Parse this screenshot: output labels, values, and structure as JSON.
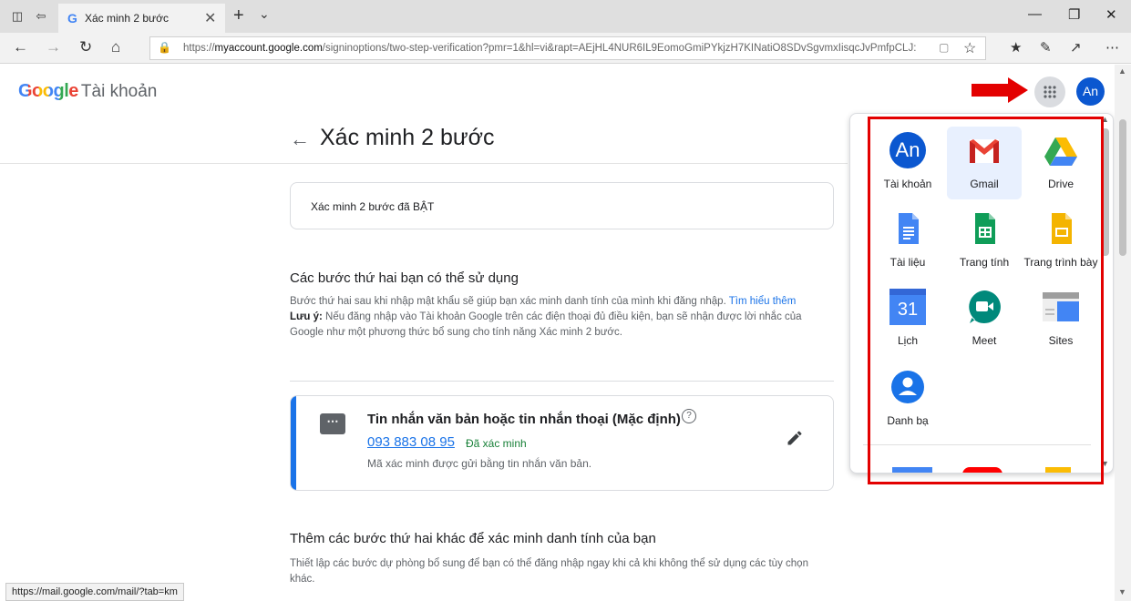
{
  "browser": {
    "tab_title": "Xác minh 2 bước",
    "tab_favicon": "G",
    "url_prefix": "https://",
    "url_domain": "myaccount.google.com",
    "url_rest": "/signinoptions/two-step-verification?pmr=1&hl=vi&rapt=AEjHL4NUR6IL9EomoGmiPYkjzH7KINatiO8SDvSgvmxIisqcJvPmfpCLJ:"
  },
  "header": {
    "logo_google": "Google",
    "logo_account": "Tài khoản",
    "avatar_initials": "An"
  },
  "page": {
    "title": "Xác minh 2 bước",
    "status_text": "Xác minh 2 bước đã BẬT",
    "section1": {
      "heading": "Các bước thứ hai bạn có thể sử dụng",
      "desc": "Bước thứ hai sau khi nhập mật khẩu sẽ giúp bạn xác minh danh tính của mình khi đăng nhập.",
      "link": "Tìm hiểu thêm",
      "note_label": "Lưu ý:",
      "note_text": "Nếu đăng nhập vào Tài khoản Google trên các điện thoại đủ điều kiện, bạn sẽ nhận được lời nhắc của Google như một phương thức bổ sung cho tính năng Xác minh 2 bước."
    },
    "method": {
      "title": "Tin nhắn văn bản hoặc tin nhắn thoại (Mặc định)",
      "phone": "093 883 08 95",
      "verified": "Đã xác minh",
      "desc": "Mã xác minh được gửi bằng tin nhắn văn bản."
    },
    "section2": {
      "heading": "Thêm các bước thứ hai khác để xác minh danh tính của bạn",
      "desc": "Thiết lập các bước dự phòng bổ sung để bạn có thể đăng nhập ngay khi cả khi không thể sử dụng các tùy chọn khác."
    }
  },
  "apps": {
    "items": [
      {
        "label": "Tài khoản",
        "icon": "account-icon"
      },
      {
        "label": "Gmail",
        "icon": "gmail-icon"
      },
      {
        "label": "Drive",
        "icon": "drive-icon"
      },
      {
        "label": "Tài liệu",
        "icon": "docs-icon"
      },
      {
        "label": "Trang tính",
        "icon": "sheets-icon"
      },
      {
        "label": "Trang trình bày",
        "icon": "slides-icon"
      },
      {
        "label": "Lịch",
        "icon": "calendar-icon"
      },
      {
        "label": "Meet",
        "icon": "meet-icon"
      },
      {
        "label": "Sites",
        "icon": "sites-icon"
      },
      {
        "label": "Danh bạ",
        "icon": "contacts-icon"
      }
    ],
    "account_initials": "An",
    "calendar_day": "31"
  },
  "statusbar": {
    "url": "https://mail.google.com/mail/?tab=km"
  },
  "colors": {
    "highlight": "#e30000",
    "google_blue": "#1a73e8",
    "verified_green": "#188038"
  }
}
